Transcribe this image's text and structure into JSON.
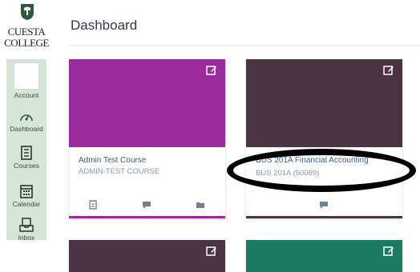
{
  "logo": {
    "line1": "CUESTA",
    "line2": "COLLEGE"
  },
  "nav": {
    "account": "Account",
    "dashboard": "Dashboard",
    "courses": "Courses",
    "calendar": "Calendar",
    "inbox": "Inbox"
  },
  "header": {
    "title": "Dashboard"
  },
  "cards": [
    {
      "title": "Admin Test Course",
      "subtitle": "ADMIN-TEST COURSE",
      "color": "#9b2a9b"
    },
    {
      "title": "BUS 201A Financial Accounting",
      "subtitle": "BUS 201A (50069)",
      "color": "#4a3443"
    },
    {
      "color": "#4a3443"
    },
    {
      "color": "#1d7a62"
    }
  ],
  "colors": {
    "nav_green": "#2b5a3c",
    "nav_active_bg": "#d4e6d6"
  }
}
